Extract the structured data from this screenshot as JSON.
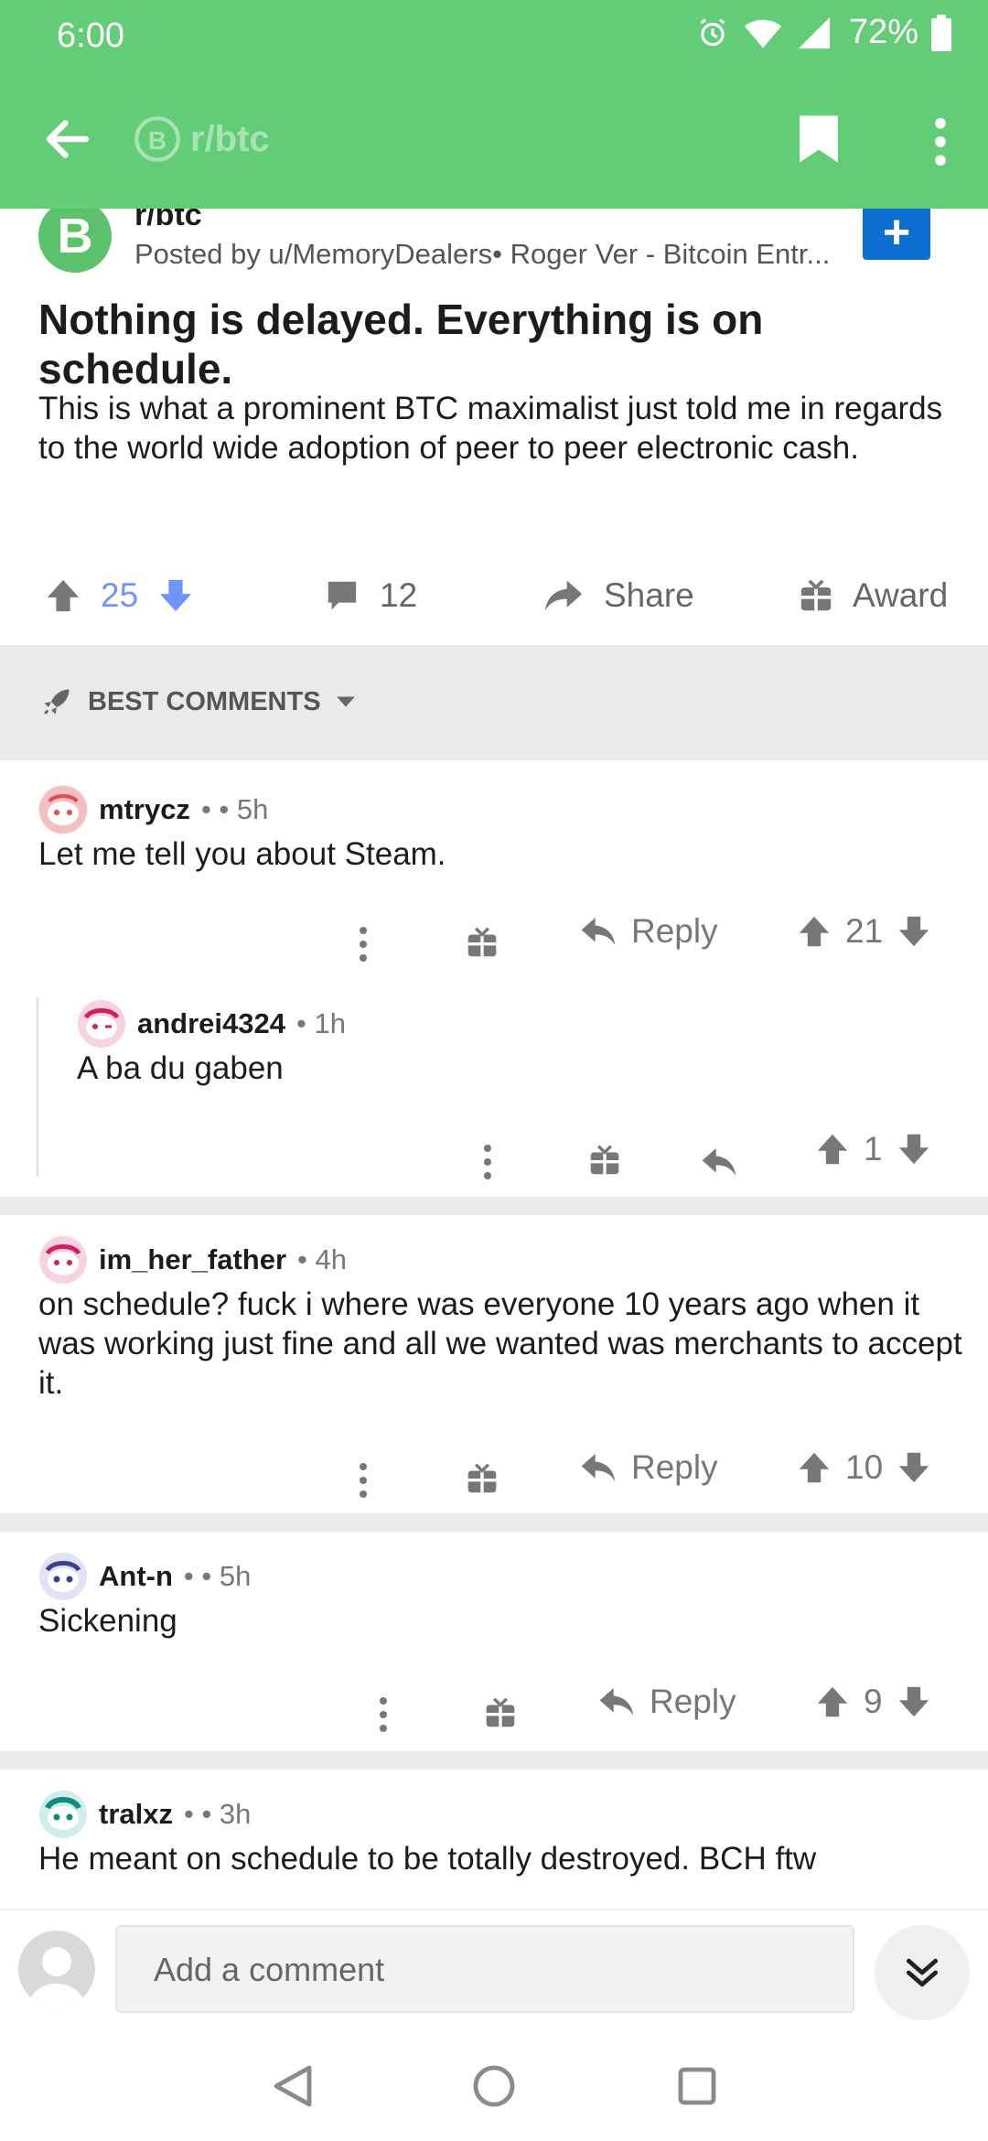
{
  "status": {
    "time": "6:00",
    "battery": "72%"
  },
  "appbar": {
    "subreddit": "r/btc"
  },
  "post": {
    "subreddit": "r/btc",
    "posted_by": "Posted by u/MemoryDealers• Roger Ver - Bitcoin Entr...",
    "title": "Nothing is delayed. Everything is on schedule.",
    "body": "This is what a prominent BTC maximalist just told me in regards to the world wide adoption of peer to peer electronic cash.",
    "score": "25",
    "comments": "12",
    "share_label": "Share",
    "award_label": "Award"
  },
  "sort": {
    "label": "BEST COMMENTS"
  },
  "comments": [
    {
      "user": "mtrycz",
      "meta": "• • 5h",
      "text": "Let me tell you about Steam.",
      "reply": "Reply",
      "score": "21"
    },
    {
      "user": "andrei4324",
      "meta": "• 1h",
      "text": "A ba du gaben",
      "score": "1"
    },
    {
      "user": "im_her_father",
      "meta": "• 4h",
      "text": "on schedule? fuck i where was everyone 10 years ago when it was working just fine and all we wanted was merchants to accept it.",
      "reply": "Reply",
      "score": "10"
    },
    {
      "user": "Ant-n",
      "meta": "• • 5h",
      "text": "Sickening",
      "reply": "Reply",
      "score": "9"
    },
    {
      "user": "tralxz",
      "meta": "• • 3h",
      "text": "He meant on schedule to be totally destroyed. BCH ftw"
    }
  ],
  "composer": {
    "placeholder": "Add a comment"
  },
  "colors": {
    "accent": "#62cc77",
    "upvote": "#7193ff",
    "join": "#0d6fd1"
  }
}
